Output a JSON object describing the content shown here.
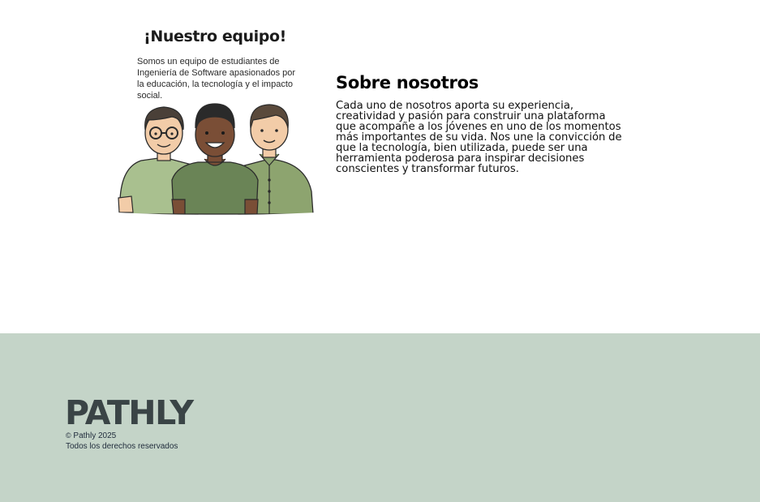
{
  "team": {
    "title": "¡Nuestro equipo!",
    "description": "Somos un equipo de estudiantes de Ingeniería de Software apasionados por la educación, la tecnología y el impacto social."
  },
  "about": {
    "title": "Sobre nosotros",
    "body": "Cada uno de nosotros aporta su experiencia, creatividad y pasión para construir una plataforma que acompañe a los jóvenes en uno de los momentos más importantes de su vida. Nos une la convicción de que la tecnología, bien utilizada, puede ser una herramienta poderosa para inspirar decisiones conscientes y transformar futuros."
  },
  "footer": {
    "brand": "PATHLY",
    "copyright_icon": "©",
    "copyright": "Pathly 2025",
    "rights": "Todos los derechos reservados"
  },
  "colors": {
    "footer_bg": "#c4d4c8",
    "brand": "#3a4446",
    "shirt_light": "#a9c08f",
    "shirt_dark": "#6a8456"
  },
  "icons": {
    "illustration": "team-illustration"
  }
}
